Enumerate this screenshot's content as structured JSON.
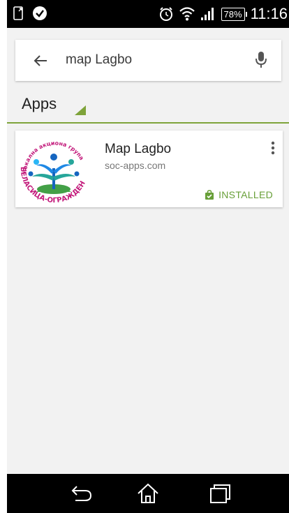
{
  "status_bar": {
    "battery_percent": "78%",
    "time": "11:16",
    "icons": [
      "screen-icon",
      "check-circle-icon",
      "alarm-icon",
      "wifi-icon",
      "signal-icon",
      "battery-icon"
    ]
  },
  "search": {
    "query": "map Lagbo",
    "icons": [
      "back-arrow-icon",
      "mic-icon"
    ]
  },
  "section": {
    "title": "Apps",
    "accent_color": "#7ea33a"
  },
  "results": [
    {
      "name": "Map Lagbo",
      "domain": "soc-apps.com",
      "status": "INSTALLED",
      "status_color": "#689f38",
      "logo_text_top": "локална акциона група",
      "logo_text_bottom": "БЕЛАСИЦА-ОГРАЖДЕН"
    }
  ],
  "nav_bar": {
    "buttons": [
      "back-icon",
      "home-icon",
      "recents-icon"
    ]
  }
}
